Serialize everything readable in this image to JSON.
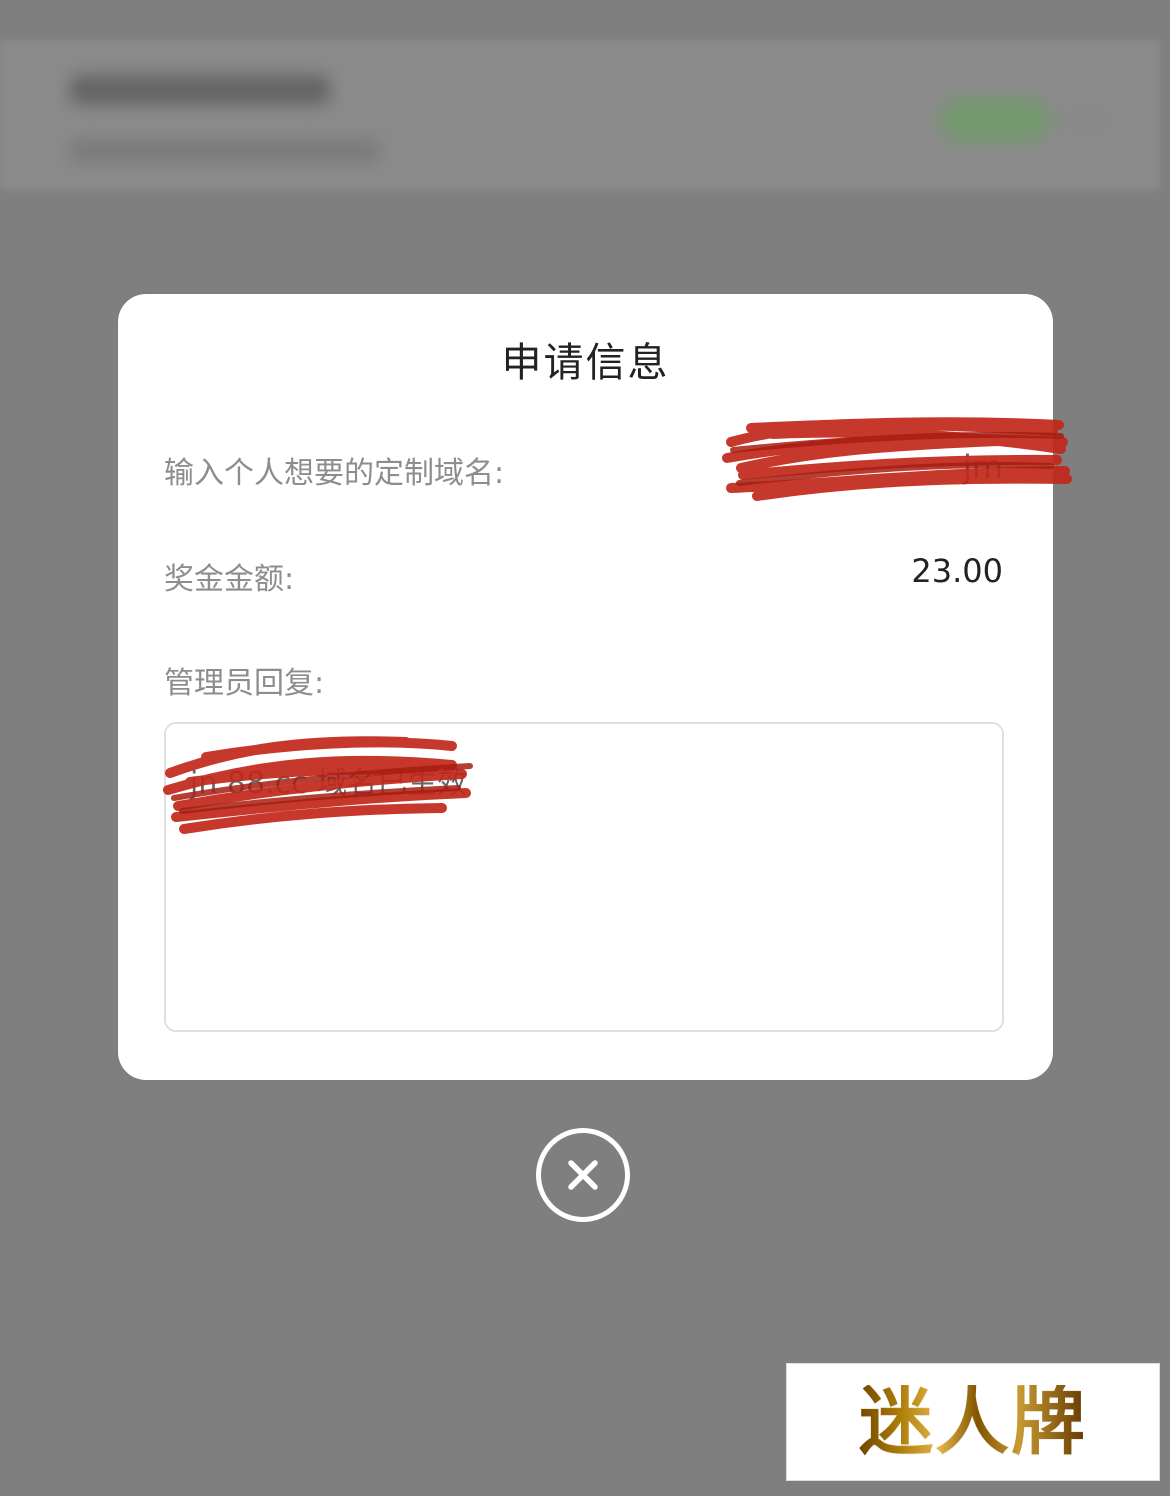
{
  "modal": {
    "title": "申请信息",
    "domain_label": "输入个人想要的定制域名:",
    "domain_value_visible": "jm",
    "bonus_label": "奖金金额:",
    "bonus_value": "23.00",
    "admin_reply_label": "管理员回复:",
    "admin_reply_visible_prefix": "jn",
    "admin_reply_visible_fragment": "88.cc",
    "admin_reply_suffix": "域名已生效"
  },
  "watermark": {
    "text": "迷人牌"
  },
  "icons": {
    "close": "close-circle-icon"
  },
  "colors": {
    "overlay": "#7f7f7f",
    "modal_bg": "#ffffff",
    "redaction": "#c1271a",
    "label_gray": "#8d8d8d",
    "value_dark": "#222222",
    "watermark_gold": "#b8860b"
  }
}
